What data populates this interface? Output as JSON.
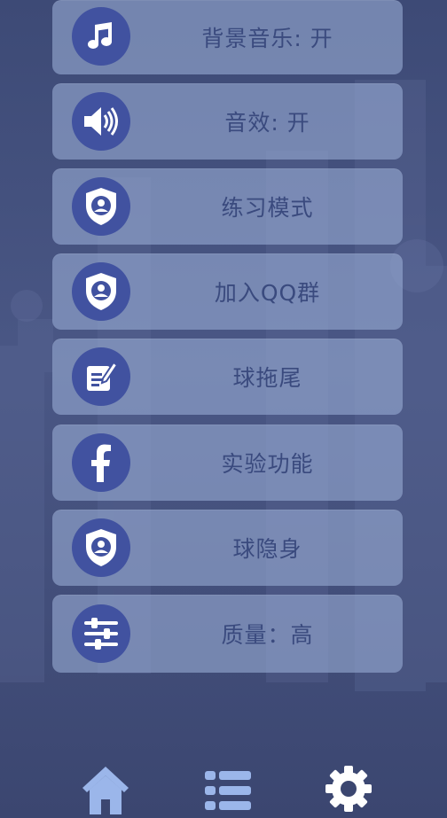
{
  "menu": {
    "items": [
      {
        "label": "背景音乐: 开",
        "icon": "music-note-icon"
      },
      {
        "label": "音效: 开",
        "icon": "speaker-icon"
      },
      {
        "label": "练习模式",
        "icon": "shield-user-icon"
      },
      {
        "label": "加入QQ群",
        "icon": "shield-user-icon"
      },
      {
        "label": "球拖尾",
        "icon": "edit-note-icon"
      },
      {
        "label": "实验功能",
        "icon": "facebook-icon"
      },
      {
        "label": "球隐身",
        "icon": "shield-user-icon"
      },
      {
        "label": "质量：高",
        "icon": "sliders-icon"
      }
    ]
  },
  "bottom_nav": {
    "items": [
      {
        "icon": "home-icon"
      },
      {
        "icon": "list-icon"
      },
      {
        "icon": "gear-icon"
      }
    ]
  },
  "colors": {
    "background": "#46527f",
    "card": "#8ea1cb",
    "icon_circle": "#4152a0",
    "label_text": "#3a4a7e",
    "nav_icon": "#9bb6ea"
  }
}
